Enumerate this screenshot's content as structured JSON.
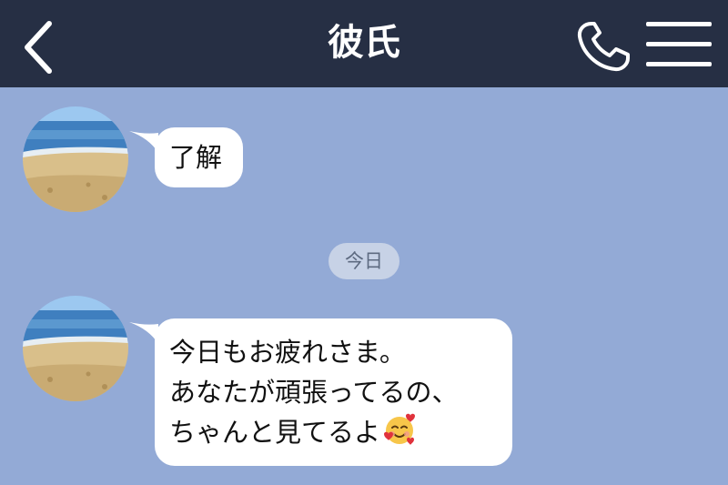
{
  "header": {
    "title": "彼氏",
    "back_icon": "chevron-left-icon",
    "call_icon": "phone-icon",
    "menu_icon": "hamburger-menu-icon"
  },
  "colors": {
    "header_bg": "#262f44",
    "chat_bg": "#93aad6",
    "bubble_bg": "#ffffff",
    "date_pill_bg": "#c7d2e6"
  },
  "chat": {
    "date_divider": "今日",
    "messages": [
      {
        "sender": "彼氏",
        "avatar_icon": "beach-photo-avatar",
        "lines": [
          "了解"
        ]
      },
      {
        "sender": "彼氏",
        "avatar_icon": "beach-photo-avatar",
        "lines": [
          "今日もお疲れさま。",
          "あなたが頑張ってるの、",
          "ちゃんと見てるよ"
        ],
        "trailing_emoji": "smiling-face-with-hearts-emoji"
      }
    ]
  }
}
